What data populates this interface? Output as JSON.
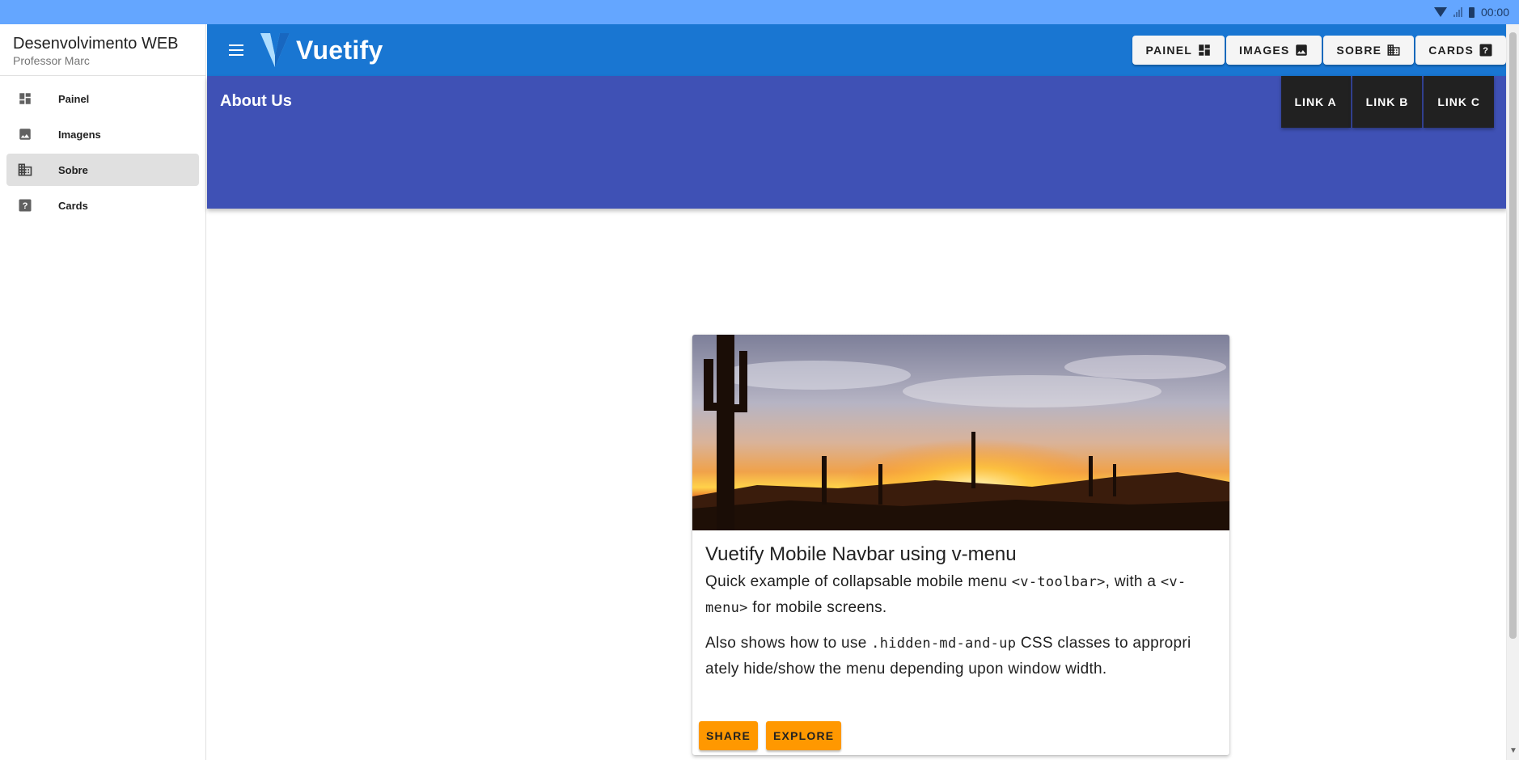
{
  "system_bar": {
    "time": "00:00",
    "icons": [
      "wifi-icon",
      "signal-icon",
      "battery-icon"
    ]
  },
  "drawer": {
    "title": "Desenvolvimento WEB",
    "subtitle": "Professor Marc",
    "items": [
      {
        "label": "Painel",
        "icon": "dashboard-icon",
        "active": false
      },
      {
        "label": "Imagens",
        "icon": "image-icon",
        "active": false
      },
      {
        "label": "Sobre",
        "icon": "business-icon",
        "active": true
      },
      {
        "label": "Cards",
        "icon": "help-icon",
        "active": false
      }
    ]
  },
  "appbar": {
    "brand": "Vuetify",
    "buttons": [
      {
        "label": "PAINEL",
        "icon": "dashboard-icon"
      },
      {
        "label": "IMAGES",
        "icon": "image-icon"
      },
      {
        "label": "SOBRE",
        "icon": "business-icon"
      },
      {
        "label": "CARDS",
        "icon": "help-icon"
      }
    ]
  },
  "subbar": {
    "title": "About Us",
    "links": [
      "LINK A",
      "LINK B",
      "LINK C"
    ]
  },
  "card": {
    "title": "Vuetify Mobile Navbar using v-menu",
    "p1_a": "Quick example of collapsable mobile menu ",
    "p1_code1": "<v-toolbar>",
    "p1_b": ", with a ",
    "p1_code2a": "<v-",
    "p1_code2b": "menu>",
    "p1_c": " for mobile screens.",
    "p2_a": "Also shows how to use ",
    "p2_code": ".hidden-md-and-up",
    "p2_b": " CSS classes to appropri",
    "p2_c": "ately hide/show the menu depending upon window width.",
    "actions": [
      "SHARE",
      "EXPLORE"
    ]
  },
  "colors": {
    "system_bar": "#64a6ff",
    "appbar": "#1976d2",
    "subbar": "#3f51b5",
    "link_buttons": "#212121",
    "card_buttons": "#ff9800"
  }
}
